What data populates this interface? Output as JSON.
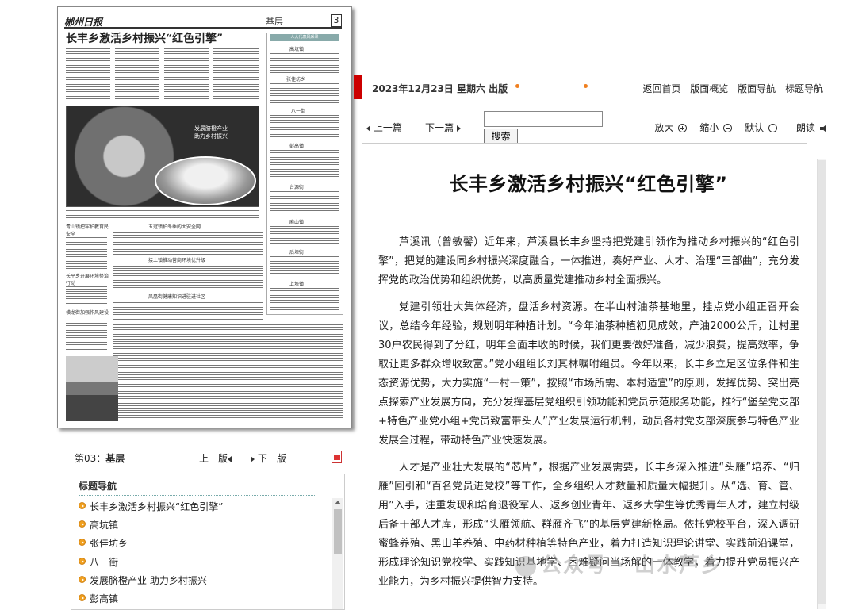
{
  "paper_thumb": {
    "masthead": "郴州日报",
    "section": "基层",
    "page_no": "3",
    "headline": "长丰乡激活乡村振兴“红色引擎”",
    "photo_caption_line1": "发展脐橙产业",
    "photo_caption_line2": "助力乡村振兴",
    "sidebar_header": "人大代表风采录",
    "sidebar_towns": [
      "高坑镇",
      "张佳坊乡",
      "八一街",
      "彭高镇",
      "台源街",
      "麻山镇",
      "后埠街",
      "上埠镇"
    ],
    "story_heads": [
      "青山镇把牢护教育民安全",
      "五冠镇护冬季的大安全网",
      "接上镇推动营商环境优升级",
      "长平乡开展环境整治行动",
      "凤凰街健康知识进驻进社区",
      "横龙街加强作风建设"
    ]
  },
  "pager": {
    "current_prefix": "第03：",
    "current_name": "基层",
    "prev_label": "上一版",
    "next_label": "下一版"
  },
  "nav": {
    "title": "标题导航",
    "items": [
      "长丰乡激活乡村振兴“红色引擎”",
      "高坑镇",
      "张佳坊乡",
      "八一街",
      "发展脐橙产业 助力乡村振兴",
      "彭高镇"
    ]
  },
  "topbar": {
    "date": "2023年12月23日 星期六 出版",
    "links": [
      "返回首页",
      "版面概览",
      "版面导航",
      "标题导航"
    ]
  },
  "toolbar": {
    "prev_article": "上一篇",
    "next_article": "下一篇",
    "search_value": "",
    "search_button": "搜索",
    "zoom_in": "放大",
    "zoom_out": "缩小",
    "default": "默认",
    "read_aloud": "朗读"
  },
  "article": {
    "title": "长丰乡激活乡村振兴“红色引擎”",
    "paragraphs": [
      "芦溪讯（曾敏馨）近年来，芦溪县长丰乡坚持把党建引领作为推动乡村振兴的“红色引擎”，把党的建设同乡村振兴深度融合，一体推进，奏好产业、人才、治理“三部曲”，充分发挥党的政治优势和组织优势，以高质量党建推动乡村全面振兴。",
      "党建引领壮大集体经济，盘活乡村资源。在半山村油茶基地里，挂点党小组正召开会议，总结今年经验，规划明年种植计划。“今年油茶种植初见成效，产油2000公斤，让村里30户农民得到了分红，明年全面丰收的时候，我们更要做好准备，减少浪费，提高效率，争取让更多群众增收致富。”党小组组长刘其林嘱咐组员。今年以来，长丰乡立足区位条件和生态资源优势，大力实施“一村一策”，按照“市场所需、本村适宜”的原则，发挥优势、突出亮点探索产业发展方向，充分发挥基层党组织引领功能和党员示范服务功能，推行“堡垒党支部+特色产业党小组+党员致富带头人”产业发展运行机制，动员各村党支部深度参与特色产业发展全过程，带动特色产业快速发展。",
      "人才是产业壮大发展的“芯片”，根据产业发展需要，长丰乡深入推进“头雁”培养、“归雁”回引和“百名党员进党校”等工作，全乡组织人才数量和质量大幅提升。从“选、育、管、用”入手，注重发现和培育退役军人、返乡创业青年、返乡大学生等优秀青年人才，建立村级后备干部人才库，形成“头雁领航、群雁齐飞”的基层党建新格局。依托党校平台，深入调研蜜蜂养殖、黑山羊养殖、中药材种植等特色产业，着力打造知识理论讲堂、实践前沿课堂，形成理论知识党校学、实践知识基地学、困难疑问当场解的一体教学，着力提升党员振兴产业能力，为乡村振兴提供智力支持。"
    ]
  },
  "watermark": "公众号 · 山水芦乡",
  "colors": {
    "accent_red": "#cc0000",
    "bullet_orange": "#f0a020"
  }
}
